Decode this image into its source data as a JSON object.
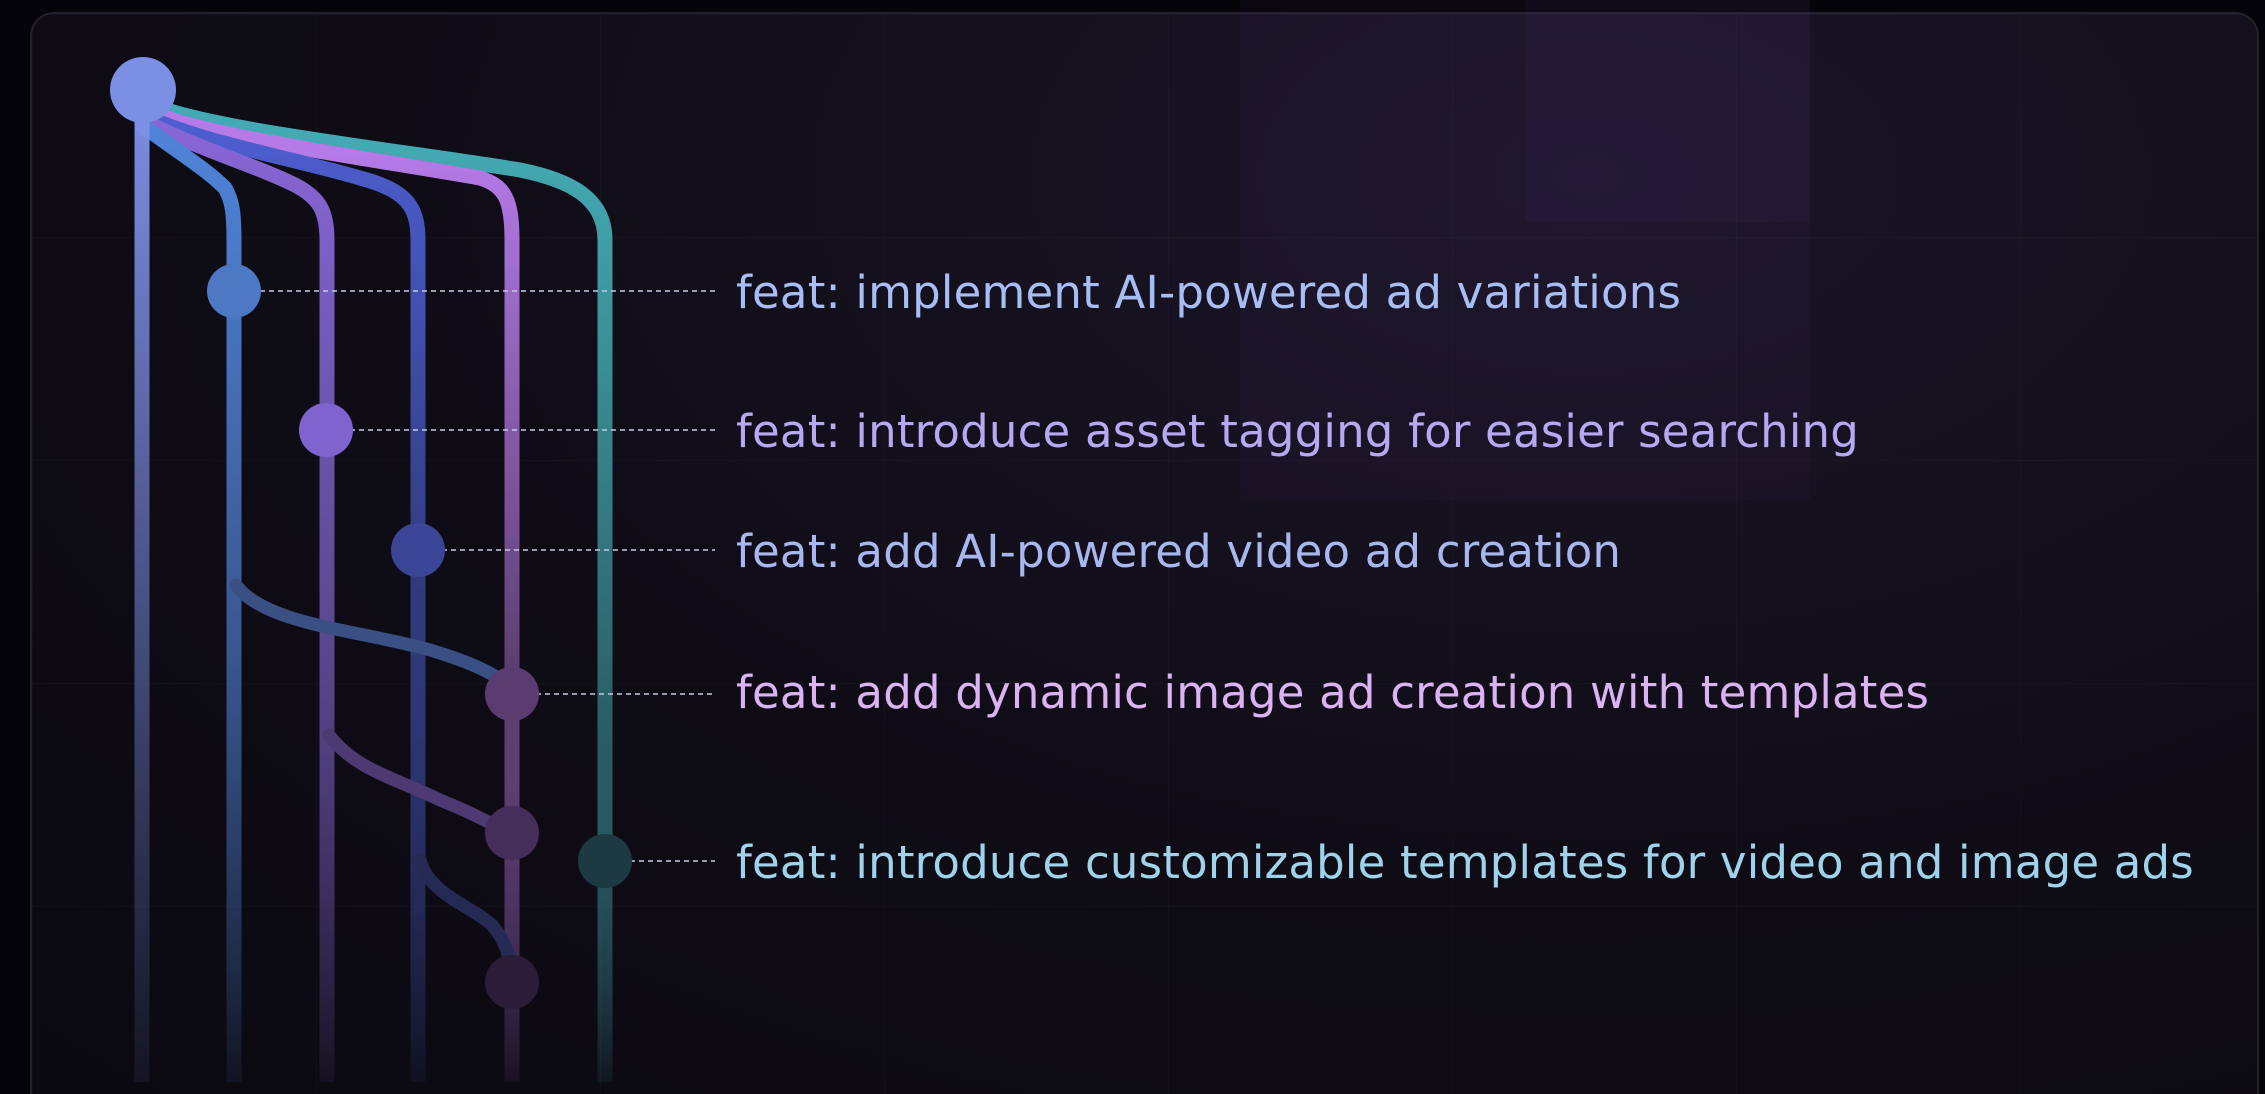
{
  "colors": {
    "root": "#7d90e6",
    "lane1": "#4f86dc",
    "lane2": "#8a67d9",
    "lane3": "#4e5fd3",
    "lane4": "#b57ae8",
    "lane5": "#43a9b2"
  },
  "commits": [
    {
      "message": "feat: implement AI-powered ad variations",
      "color": "#a9bdf5"
    },
    {
      "message": "feat: introduce asset tagging for easier searching",
      "color": "#b7a8f2"
    },
    {
      "message": "feat: add AI-powered video ad creation",
      "color": "#a9b7ef"
    },
    {
      "message": "feat: add dynamic image ad creation with templates",
      "color": "#dab3f2"
    },
    {
      "message": "feat: introduce customizable templates for video and image ads",
      "color": "#9fd3ea"
    }
  ]
}
